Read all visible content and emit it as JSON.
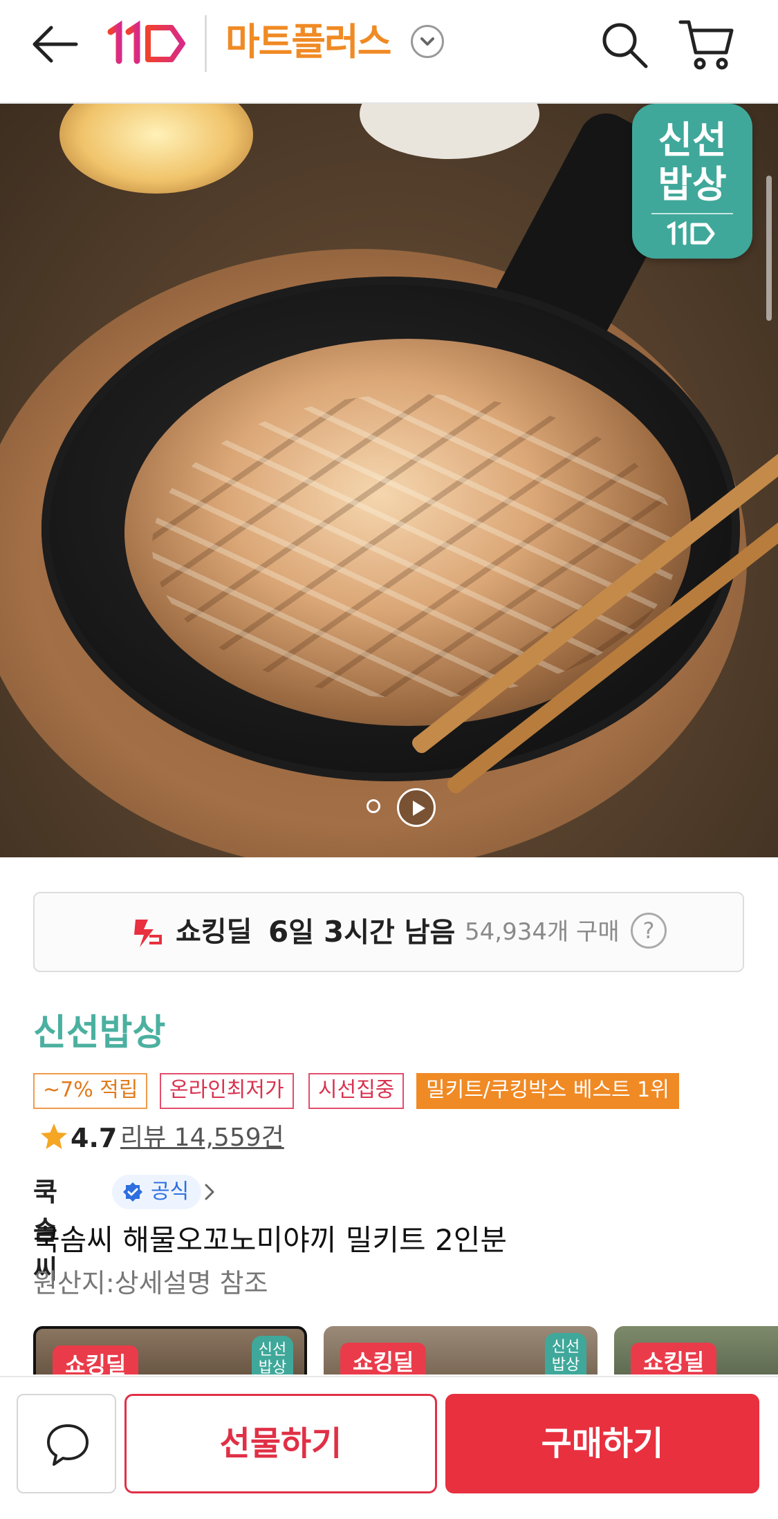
{
  "header": {
    "logo_text": "11",
    "title": "마트플러스",
    "brand_color": "#f04e3e",
    "accent": "#f08a24"
  },
  "hero": {
    "badge_line1": "신선",
    "badge_line2": "밥상",
    "badge_logo": "11"
  },
  "deal": {
    "label": "쇼킹딜",
    "time_days_num": "6",
    "time_days_unit": "일",
    "time_hours_num": "3",
    "time_hours_unit": "시간 남음",
    "purchase_count": "54,934개 구매",
    "help": "?"
  },
  "product": {
    "brand": "신선밥상",
    "tags": [
      "~7% 적립",
      "온라인최저가",
      "시선집중",
      "밀키트/쿠킹박스 베스트 1위"
    ],
    "rating": "4.7",
    "review": "리뷰 14,559건",
    "seller": "쿡솜씨",
    "official": "공식",
    "title": "쿡솜씨 해물오꼬노미야끼 밀키트 2인분",
    "origin": "원산지:상세설명 참조"
  },
  "thumbnails": [
    {
      "label": "쇼킹딜",
      "badge": "신선\n밥상",
      "selected": true
    },
    {
      "label": "쇼킹딜",
      "badge": "신선\n밥상",
      "selected": false
    },
    {
      "label": "쇼킹딜",
      "badge": "",
      "selected": false
    }
  ],
  "bottom": {
    "gift": "선물하기",
    "buy": "구매하기"
  }
}
